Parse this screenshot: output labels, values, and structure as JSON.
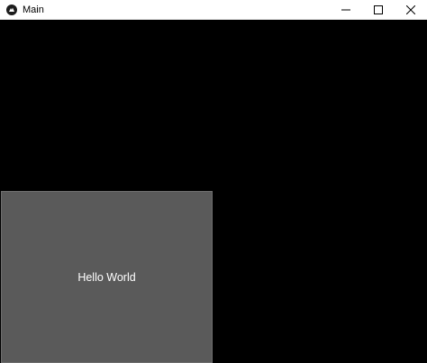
{
  "window": {
    "title": "Main",
    "app_icon": "kivy-logo-icon",
    "controls": {
      "minimize_icon": "minimize-icon",
      "maximize_icon": "maximize-icon",
      "close_icon": "close-icon"
    }
  },
  "content": {
    "background_color": "#000000",
    "panel": {
      "label": "Hello World",
      "background_color": "#5a5a5a",
      "text_color": "#ffffff"
    }
  }
}
